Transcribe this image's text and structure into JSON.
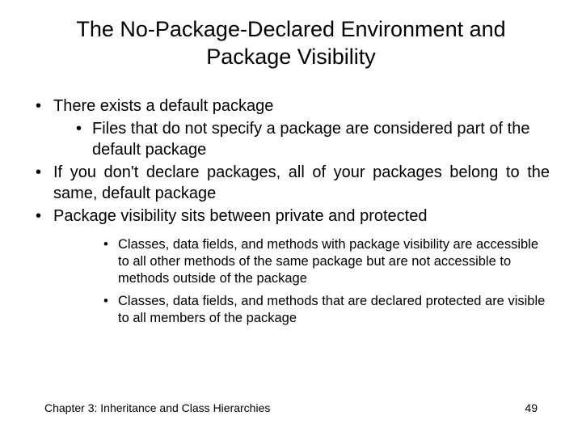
{
  "title": "The No-Package-Declared Environment and Package Visibility",
  "bullets": {
    "b1": "There exists a default package",
    "b1_1": "Files that do not specify a package are considered part of the default package",
    "b2": "If you don't declare packages, all of your packages belong to the same, default package",
    "b3": "Package visibility sits between private and protected",
    "b3_1": "Classes, data fields, and methods with package visibility are accessible to all other methods of the same package but are not accessible to methods outside of the package",
    "b3_2": "Classes, data fields, and methods that are declared protected are visible to all members of the package"
  },
  "footer": {
    "chapter": "Chapter 3: Inheritance and Class Hierarchies",
    "page": "49"
  }
}
